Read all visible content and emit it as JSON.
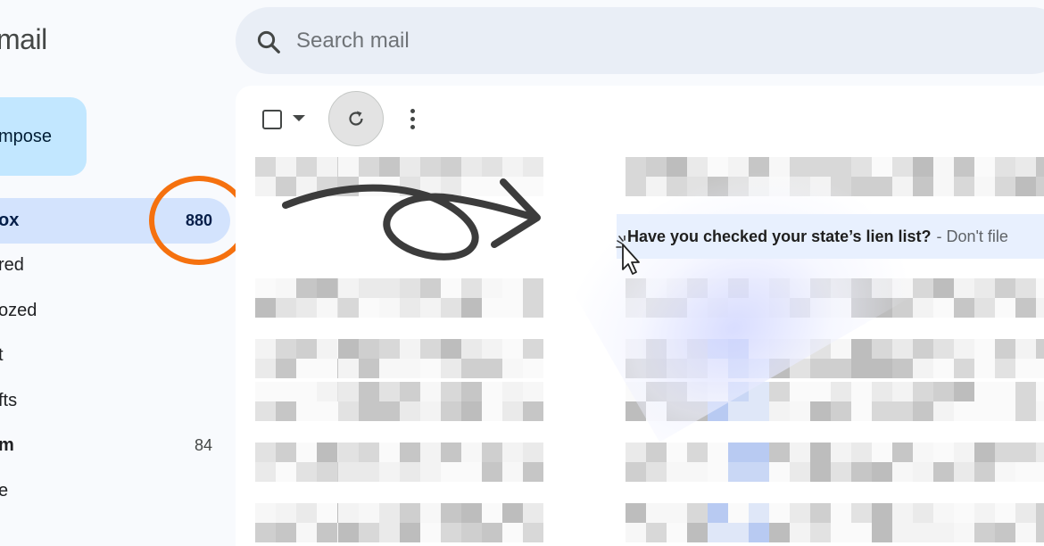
{
  "app": {
    "logo_text": "mail"
  },
  "compose": {
    "label": "mpose"
  },
  "search": {
    "placeholder": "Search mail"
  },
  "nav": {
    "items": [
      {
        "label": "ox",
        "count": "880",
        "active": true
      },
      {
        "label": "red",
        "count": ""
      },
      {
        "label": "ozed",
        "count": ""
      },
      {
        "label": "t",
        "count": ""
      },
      {
        "label": "fts",
        "count": ""
      },
      {
        "label": "m",
        "count": "84"
      },
      {
        "label": "e",
        "count": ""
      }
    ]
  },
  "email": {
    "subject": "Have you checked your state’s lien list?",
    "snippet": "- Don't file"
  },
  "colors": {
    "accent_ring": "#f5710f",
    "active_nav": "#d3e3fd",
    "compose_bg": "#c2e7ff",
    "selected_row": "#e8f0fe"
  },
  "icons": {
    "search": "search-icon",
    "refresh": "refresh-icon",
    "more": "more-vert-icon",
    "checkbox": "checkbox-icon",
    "caret": "caret-down-icon",
    "cursor": "mouse-pointer-icon",
    "arrow": "curly-arrow-icon"
  }
}
